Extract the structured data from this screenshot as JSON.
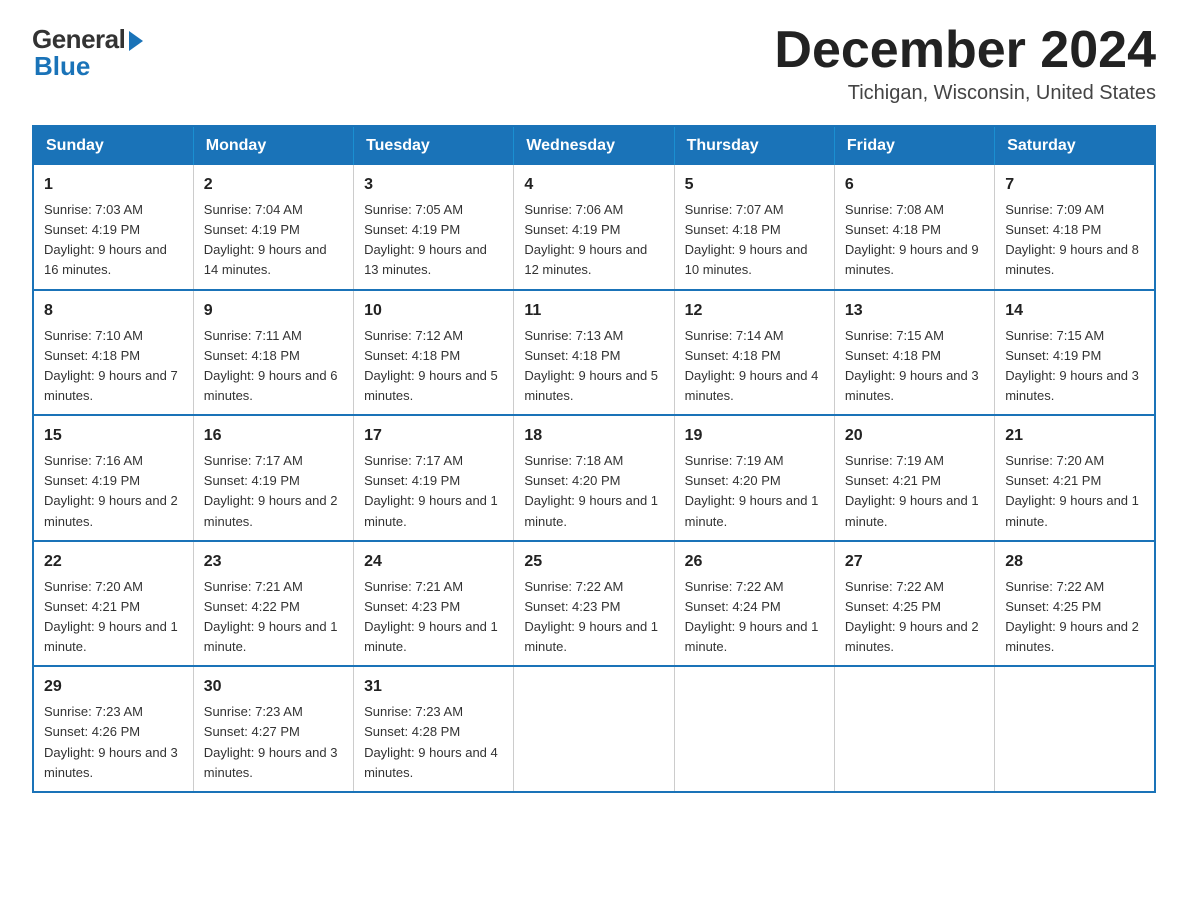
{
  "header": {
    "logo_general": "General",
    "logo_blue": "Blue",
    "month_title": "December 2024",
    "location": "Tichigan, Wisconsin, United States"
  },
  "days_of_week": [
    "Sunday",
    "Monday",
    "Tuesday",
    "Wednesday",
    "Thursday",
    "Friday",
    "Saturday"
  ],
  "weeks": [
    [
      {
        "day": "1",
        "sunrise": "7:03 AM",
        "sunset": "4:19 PM",
        "daylight": "9 hours and 16 minutes."
      },
      {
        "day": "2",
        "sunrise": "7:04 AM",
        "sunset": "4:19 PM",
        "daylight": "9 hours and 14 minutes."
      },
      {
        "day": "3",
        "sunrise": "7:05 AM",
        "sunset": "4:19 PM",
        "daylight": "9 hours and 13 minutes."
      },
      {
        "day": "4",
        "sunrise": "7:06 AM",
        "sunset": "4:19 PM",
        "daylight": "9 hours and 12 minutes."
      },
      {
        "day": "5",
        "sunrise": "7:07 AM",
        "sunset": "4:18 PM",
        "daylight": "9 hours and 10 minutes."
      },
      {
        "day": "6",
        "sunrise": "7:08 AM",
        "sunset": "4:18 PM",
        "daylight": "9 hours and 9 minutes."
      },
      {
        "day": "7",
        "sunrise": "7:09 AM",
        "sunset": "4:18 PM",
        "daylight": "9 hours and 8 minutes."
      }
    ],
    [
      {
        "day": "8",
        "sunrise": "7:10 AM",
        "sunset": "4:18 PM",
        "daylight": "9 hours and 7 minutes."
      },
      {
        "day": "9",
        "sunrise": "7:11 AM",
        "sunset": "4:18 PM",
        "daylight": "9 hours and 6 minutes."
      },
      {
        "day": "10",
        "sunrise": "7:12 AM",
        "sunset": "4:18 PM",
        "daylight": "9 hours and 5 minutes."
      },
      {
        "day": "11",
        "sunrise": "7:13 AM",
        "sunset": "4:18 PM",
        "daylight": "9 hours and 5 minutes."
      },
      {
        "day": "12",
        "sunrise": "7:14 AM",
        "sunset": "4:18 PM",
        "daylight": "9 hours and 4 minutes."
      },
      {
        "day": "13",
        "sunrise": "7:15 AM",
        "sunset": "4:18 PM",
        "daylight": "9 hours and 3 minutes."
      },
      {
        "day": "14",
        "sunrise": "7:15 AM",
        "sunset": "4:19 PM",
        "daylight": "9 hours and 3 minutes."
      }
    ],
    [
      {
        "day": "15",
        "sunrise": "7:16 AM",
        "sunset": "4:19 PM",
        "daylight": "9 hours and 2 minutes."
      },
      {
        "day": "16",
        "sunrise": "7:17 AM",
        "sunset": "4:19 PM",
        "daylight": "9 hours and 2 minutes."
      },
      {
        "day": "17",
        "sunrise": "7:17 AM",
        "sunset": "4:19 PM",
        "daylight": "9 hours and 1 minute."
      },
      {
        "day": "18",
        "sunrise": "7:18 AM",
        "sunset": "4:20 PM",
        "daylight": "9 hours and 1 minute."
      },
      {
        "day": "19",
        "sunrise": "7:19 AM",
        "sunset": "4:20 PM",
        "daylight": "9 hours and 1 minute."
      },
      {
        "day": "20",
        "sunrise": "7:19 AM",
        "sunset": "4:21 PM",
        "daylight": "9 hours and 1 minute."
      },
      {
        "day": "21",
        "sunrise": "7:20 AM",
        "sunset": "4:21 PM",
        "daylight": "9 hours and 1 minute."
      }
    ],
    [
      {
        "day": "22",
        "sunrise": "7:20 AM",
        "sunset": "4:21 PM",
        "daylight": "9 hours and 1 minute."
      },
      {
        "day": "23",
        "sunrise": "7:21 AM",
        "sunset": "4:22 PM",
        "daylight": "9 hours and 1 minute."
      },
      {
        "day": "24",
        "sunrise": "7:21 AM",
        "sunset": "4:23 PM",
        "daylight": "9 hours and 1 minute."
      },
      {
        "day": "25",
        "sunrise": "7:22 AM",
        "sunset": "4:23 PM",
        "daylight": "9 hours and 1 minute."
      },
      {
        "day": "26",
        "sunrise": "7:22 AM",
        "sunset": "4:24 PM",
        "daylight": "9 hours and 1 minute."
      },
      {
        "day": "27",
        "sunrise": "7:22 AM",
        "sunset": "4:25 PM",
        "daylight": "9 hours and 2 minutes."
      },
      {
        "day": "28",
        "sunrise": "7:22 AM",
        "sunset": "4:25 PM",
        "daylight": "9 hours and 2 minutes."
      }
    ],
    [
      {
        "day": "29",
        "sunrise": "7:23 AM",
        "sunset": "4:26 PM",
        "daylight": "9 hours and 3 minutes."
      },
      {
        "day": "30",
        "sunrise": "7:23 AM",
        "sunset": "4:27 PM",
        "daylight": "9 hours and 3 minutes."
      },
      {
        "day": "31",
        "sunrise": "7:23 AM",
        "sunset": "4:28 PM",
        "daylight": "9 hours and 4 minutes."
      },
      null,
      null,
      null,
      null
    ]
  ]
}
